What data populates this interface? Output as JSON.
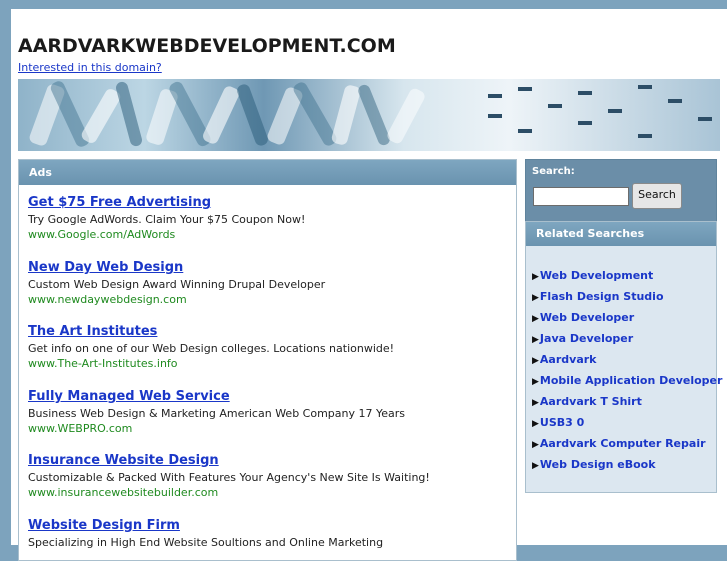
{
  "header": {
    "domain": "AARDVARKWEBDEVELOPMENT.COM",
    "interest_link": "Interested in this domain?"
  },
  "ads": {
    "heading": "Ads",
    "items": [
      {
        "title": "Get $75 Free Advertising",
        "desc": "Try Google AdWords. Claim Your $75 Coupon Now!",
        "url": "www.Google.com/AdWords"
      },
      {
        "title": "New Day Web Design",
        "desc": "Custom Web Design Award Winning Drupal Developer",
        "url": "www.newdaywebdesign.com"
      },
      {
        "title": "The Art Institutes",
        "desc": "Get info on one of our Web Design colleges. Locations nationwide!",
        "url": "www.The-Art-Institutes.info"
      },
      {
        "title": "Fully Managed Web Service",
        "desc": "Business Web Design & Marketing American Web Company 17 Years",
        "url": "www.WEBPRO.com"
      },
      {
        "title": "Insurance Website Design",
        "desc": "Customizable & Packed With Features Your Agency's New Site Is Waiting!",
        "url": "www.insurancewebsitebuilder.com"
      },
      {
        "title": "Website Design Firm",
        "desc": "Specializing in High End Website Soultions and Online Marketing",
        "url": ""
      }
    ]
  },
  "search": {
    "label": "Search:",
    "value": "",
    "button": "Search"
  },
  "related": {
    "heading": "Related Searches",
    "items": [
      "Web Development",
      "Flash Design Studio",
      "Web Developer",
      "Java Developer",
      "Aardvark",
      "Mobile Application Developer",
      "Aardvark T Shirt",
      "USB3 0",
      "Aardvark Computer Repair",
      "Web Design eBook"
    ]
  },
  "colors": {
    "background": "#7da3bd",
    "panel_header": "#6e96b1",
    "link": "#1a37c8",
    "ad_url": "#1f8a1f",
    "related_bg": "#dce7f0"
  }
}
